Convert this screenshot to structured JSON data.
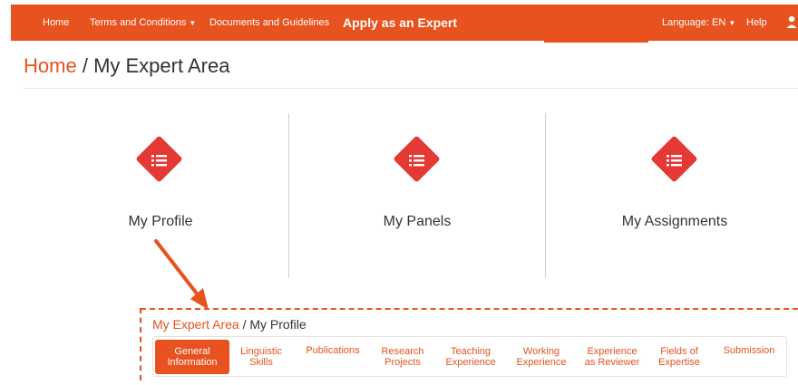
{
  "nav": {
    "home": "Home",
    "terms": "Terms and Conditions",
    "documents": "Documents and Guidelines",
    "apply": "Apply as an Expert",
    "language": "Language: EN",
    "help": "Help"
  },
  "breadcrumb": {
    "home": "Home",
    "separator": "/",
    "current": "My Expert Area"
  },
  "tiles": [
    {
      "label": "My Profile",
      "icon": "list-icon"
    },
    {
      "label": "My Panels",
      "icon": "list-icon"
    },
    {
      "label": "My Assignments",
      "icon": "list-icon"
    }
  ],
  "inset": {
    "breadcrumb": {
      "parent": "My Expert Area",
      "separator": "/",
      "current": "My Profile"
    },
    "tabs": [
      {
        "line1": "General",
        "line2": "Information",
        "active": true
      },
      {
        "line1": "Linguistic",
        "line2": "Skills"
      },
      {
        "line1": "Publications",
        "line2": ""
      },
      {
        "line1": "Research",
        "line2": "Projects"
      },
      {
        "line1": "Teaching",
        "line2": "Experience"
      },
      {
        "line1": "Working",
        "line2": "Experience"
      },
      {
        "line1": "Experience",
        "line2": "as Reviewer"
      },
      {
        "line1": "Fields of",
        "line2": "Expertise"
      },
      {
        "line1": "Submission",
        "line2": ""
      }
    ]
  },
  "colors": {
    "brand": "#e8521e",
    "icon": "#e53935"
  }
}
